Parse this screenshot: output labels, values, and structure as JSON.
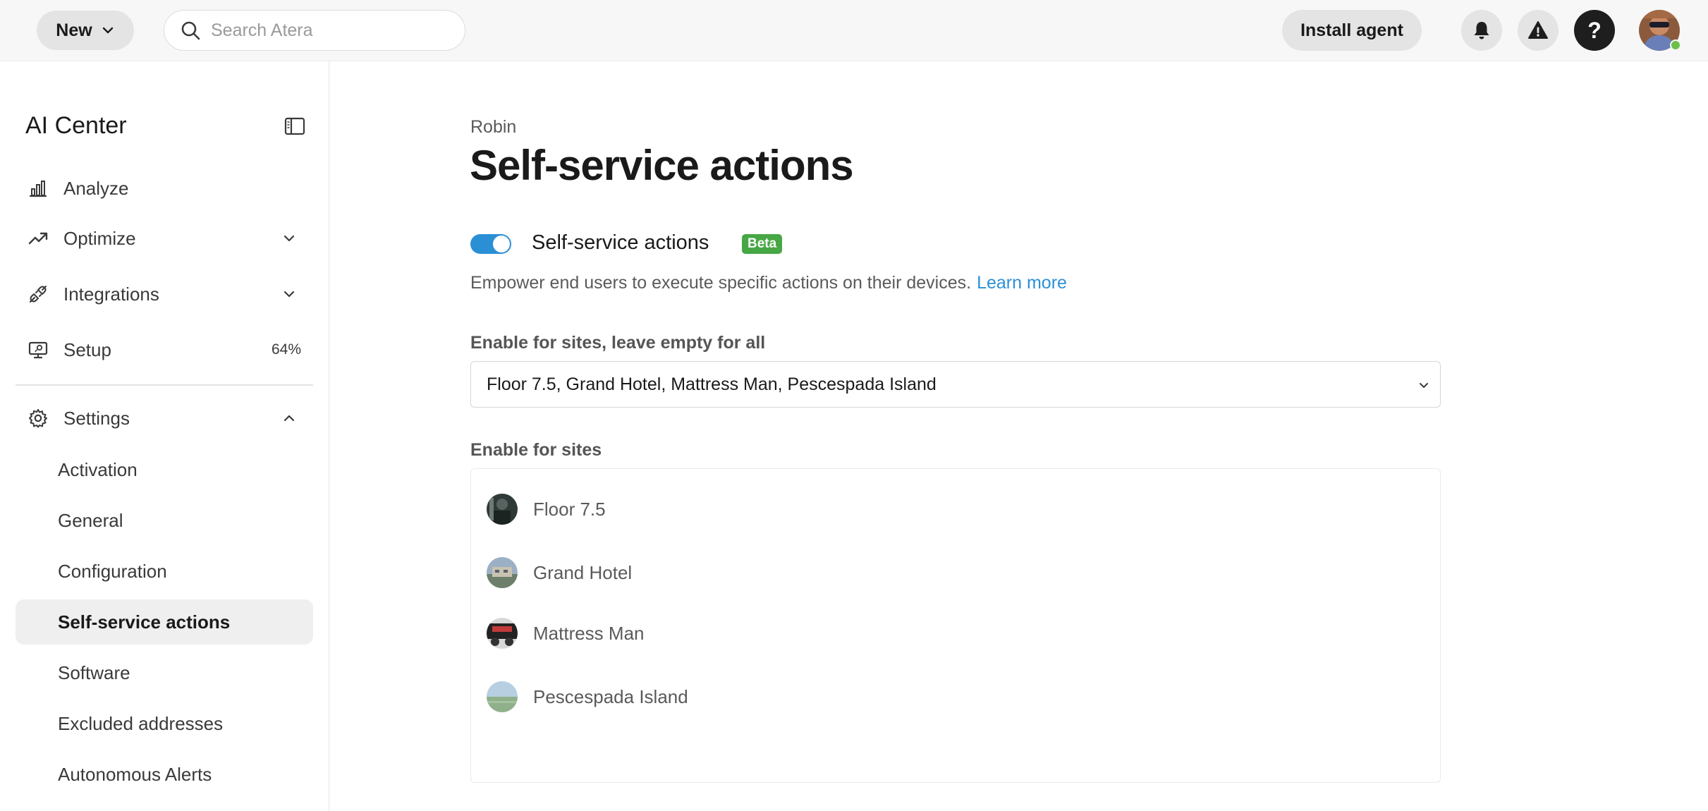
{
  "topbar": {
    "new_label": "New",
    "search_placeholder": "Search Atera",
    "install_label": "Install agent",
    "help_glyph": "?"
  },
  "sidebar": {
    "title": "AI Center",
    "items": [
      {
        "label": "Analyze",
        "icon": "bar-chart-icon"
      },
      {
        "label": "Optimize",
        "icon": "trend-up-icon"
      },
      {
        "label": "Integrations",
        "icon": "plug-icon"
      },
      {
        "label": "Setup",
        "icon": "monitor-setup-icon",
        "progress": "64%"
      },
      {
        "label": "Settings",
        "icon": "gear-icon"
      }
    ],
    "settings_items": [
      {
        "label": "Activation"
      },
      {
        "label": "General"
      },
      {
        "label": "Configuration"
      },
      {
        "label": "Self-service actions",
        "active": true
      },
      {
        "label": "Software"
      },
      {
        "label": "Excluded addresses"
      },
      {
        "label": "Autonomous Alerts"
      }
    ]
  },
  "main": {
    "breadcrumb": "Robin",
    "title": "Self-service actions",
    "toggle_label": "Self-service actions",
    "toggle_on": true,
    "badge": "Beta",
    "description": "Empower end users to execute specific actions on their devices.",
    "learn_more": "Learn more",
    "select_label": "Enable for sites, leave empty for all",
    "select_value": "Floor 7.5, Grand Hotel, Mattress Man, Pescespada Island",
    "sites_label": "Enable for sites",
    "sites": [
      {
        "name": "Floor 7.5"
      },
      {
        "name": "Grand Hotel"
      },
      {
        "name": "Mattress Man"
      },
      {
        "name": "Pescespada Island"
      }
    ]
  },
  "colors": {
    "accent": "#2b8fd6",
    "beta_badge": "#46a744",
    "online_status": "#6cc04a"
  }
}
